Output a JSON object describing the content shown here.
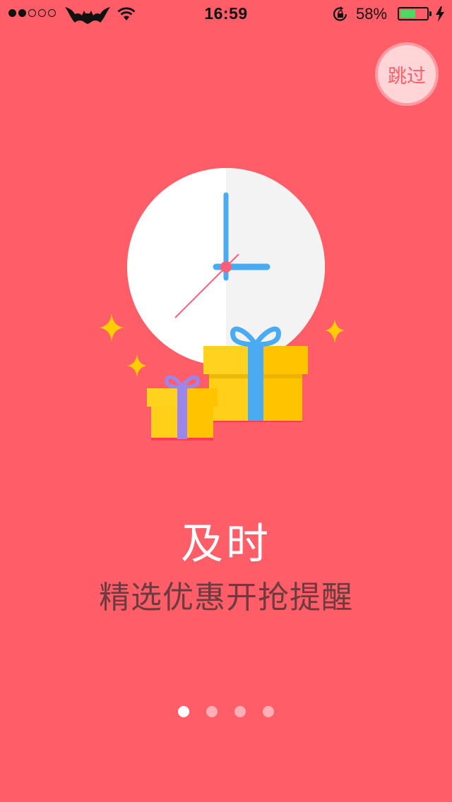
{
  "status_bar": {
    "time": "16:59",
    "battery_percent": "58%",
    "battery_level": 0.58,
    "signal_strength": 2,
    "signal_total": 5
  },
  "skip": {
    "label": "跳过"
  },
  "content": {
    "title": "及时",
    "subtitle": "精选优惠开抢提醒"
  },
  "pager": {
    "total": 4,
    "active_index": 0
  },
  "colors": {
    "background": "#ff5e69",
    "accent_blue": "#4aaaf2",
    "gift_yellow": "#ffcc00",
    "battery_green": "#4cd964"
  }
}
